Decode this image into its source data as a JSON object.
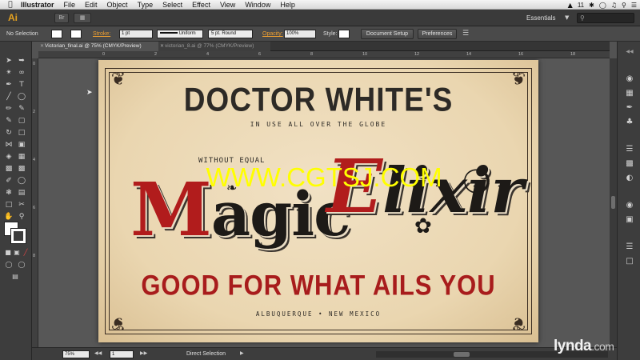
{
  "menubar": {
    "app_name": "Illustrator",
    "items": [
      "File",
      "Edit",
      "Object",
      "Type",
      "Select",
      "Effect",
      "View",
      "Window",
      "Help"
    ],
    "status_right": "11"
  },
  "appbar": {
    "logo": "Ai",
    "br_button": "Br",
    "workspace": "Essentials"
  },
  "controlbar": {
    "selection": "No Selection",
    "stroke_label": "Stroke:",
    "stroke_value": "1 pt",
    "uniform": "Uniform",
    "brush": "5 pt. Round",
    "opacity_label": "Opacity:",
    "opacity_value": "100%",
    "style_label": "Style:",
    "document_setup": "Document Setup",
    "preferences": "Preferences"
  },
  "tabs": [
    {
      "label": "Victorian_final.ai @ 75% (CMYK/Preview)"
    },
    {
      "label": "victorian_8.ai @ 77% (CMYK/Preview)"
    }
  ],
  "ruler": {
    "h_ticks": [
      "0",
      "2",
      "4",
      "6",
      "8",
      "10",
      "12",
      "14",
      "16",
      "18"
    ],
    "v_ticks": [
      "0",
      "2",
      "4",
      "6",
      "8"
    ]
  },
  "artwork": {
    "title": "DOCTOR WHITE'S",
    "subtitle": "IN USE ALL OVER THE GLOBE",
    "without_equal": "WITHOUT EQUAL",
    "magic_cap": "M",
    "magic_rest": "agic",
    "elixir_cap": "E",
    "elixir_rest": "lixir",
    "tagline": "GOOD FOR WHAT AILS YOU",
    "location": "ALBUQUERQUE • NEW MEXICO"
  },
  "watermark": "WWW.CGTSJ.COM",
  "statusbar": {
    "zoom": "75%",
    "artboard_num": "1",
    "tool_status": "Direct Selection"
  },
  "brand": {
    "name": "lynda",
    "suffix": ".com"
  }
}
